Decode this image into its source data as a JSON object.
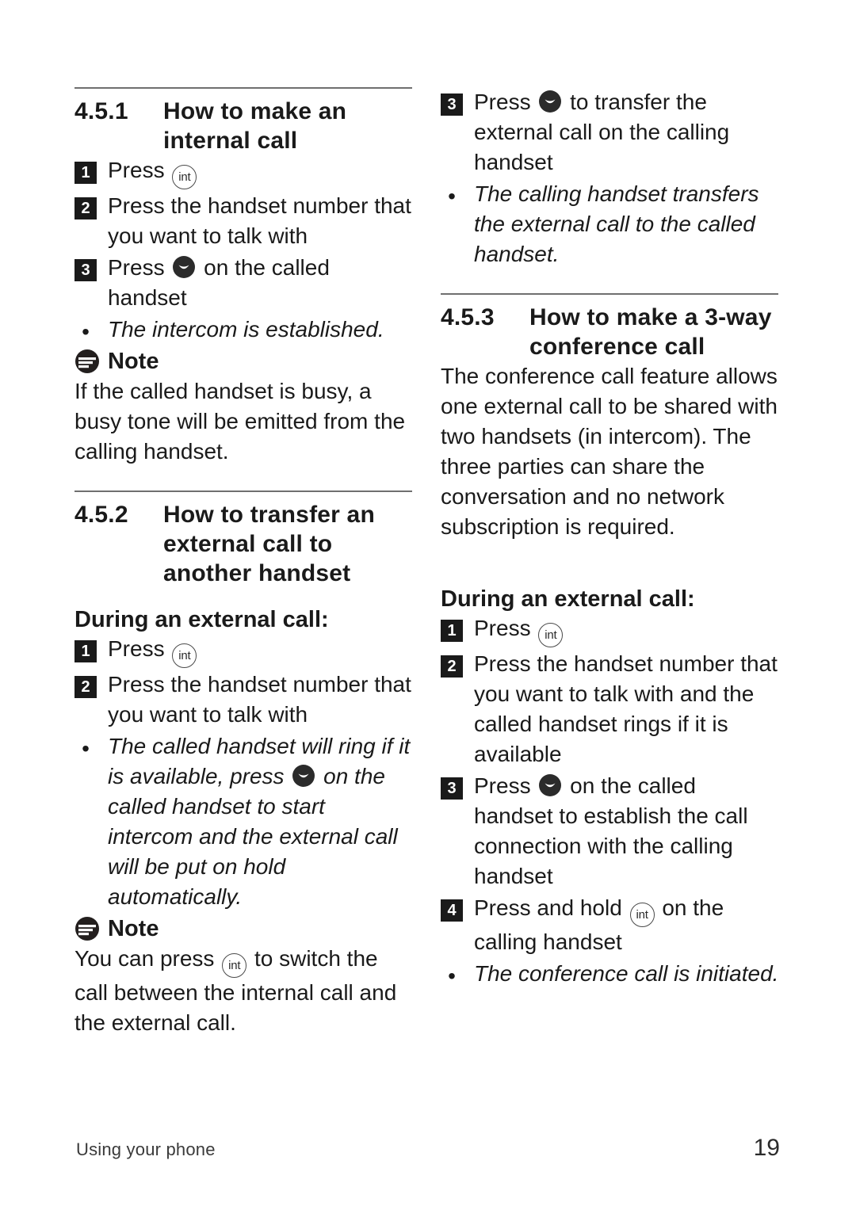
{
  "page": {
    "footer_label": "Using your phone",
    "page_number": "19"
  },
  "icons": {
    "int": "int-key-icon",
    "talk": "talk-key-icon",
    "note": "note-icon",
    "int_text": "int"
  },
  "left_column": {
    "section_451": {
      "number": "4.5.1",
      "title": "How to make an internal call",
      "steps": [
        {
          "num": "1",
          "text_before": "Press ",
          "icon": "int",
          "text_after": ""
        },
        {
          "num": "2",
          "text_before": "Press the handset number that you want to talk with",
          "icon": "",
          "text_after": ""
        },
        {
          "num": "3",
          "text_before": "Press ",
          "icon": "talk",
          "text_after": " on the called handset"
        }
      ],
      "bullet": "The intercom is established.",
      "note_label": "Note",
      "note_text": "If the called handset is busy, a busy tone will be emitted from the calling handset."
    },
    "section_452": {
      "number": "4.5.2",
      "title": "How to transfer an external call to another handset",
      "sub_head": "During an external call:",
      "steps": [
        {
          "num": "1",
          "text_before": "Press ",
          "icon": "int",
          "text_after": ""
        },
        {
          "num": "2",
          "text_before": "Press the handset number that you want to talk with",
          "icon": "",
          "text_after": ""
        }
      ],
      "bullet_part1": "The called handset will ring if it is available, press ",
      "bullet_icon": "talk",
      "bullet_part2": " on the called handset to start intercom and the external call will be put on hold automatically.",
      "note_label": "Note",
      "note_part1": "You can press ",
      "note_icon": "int",
      "note_part2": " to switch the call between the internal call and the external call."
    }
  },
  "right_column": {
    "section_452_cont": {
      "step": {
        "num": "3",
        "text_before": "Press ",
        "icon": "talk",
        "text_after": " to transfer the external call on the calling handset"
      },
      "bullet": "The calling handset transfers the external call to the called handset."
    },
    "section_453": {
      "number": "4.5.3",
      "title": "How to make a 3-way conference call",
      "intro": "The conference call feature allows one external call to be shared with two handsets (in intercom). The three parties can share the conversation and no network subscription is required.",
      "sub_head": "During an external call:",
      "steps": [
        {
          "num": "1",
          "text_before": "Press ",
          "icon": "int",
          "text_after": ""
        },
        {
          "num": "2",
          "text_before": "Press the handset number that you want to talk with and the called handset rings if it is available",
          "icon": "",
          "text_after": ""
        },
        {
          "num": "3",
          "text_before": "Press ",
          "icon": "talk",
          "text_after": " on the called handset to establish the call connection with the calling handset"
        },
        {
          "num": "4",
          "text_before": "Press and hold ",
          "icon": "int",
          "text_after": " on the calling handset"
        }
      ],
      "bullet": "The conference call is initiated."
    }
  }
}
